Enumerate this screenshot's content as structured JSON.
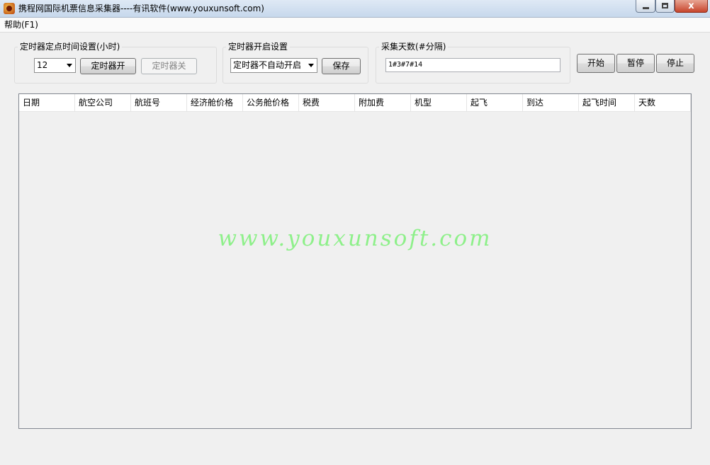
{
  "window": {
    "title": "携程网国际机票信息采集器----有讯软件(www.youxunsoft.com)",
    "close_glyph": "x"
  },
  "menu": {
    "help": "帮助(F1)"
  },
  "timer_time_group": {
    "legend": "定时器定点时间设置(小时)",
    "hour_value": "12",
    "timer_on_label": "定时器开",
    "timer_off_label": "定时器关"
  },
  "timer_start_group": {
    "legend": "定时器开启设置",
    "mode_value": "定时器不自动开启",
    "save_label": "保存"
  },
  "days_group": {
    "legend": "采集天数(#分隔)",
    "value": "1#3#7#14"
  },
  "actions": {
    "start_label": "开始",
    "pause_label": "暂停",
    "stop_label": "停止"
  },
  "table": {
    "columns": [
      "日期",
      "航空公司",
      "航班号",
      "经济舱价格",
      "公务舱价格",
      "税费",
      "附加费",
      "机型",
      "起飞",
      "到达",
      "起飞时间",
      "天数"
    ],
    "rows": []
  },
  "watermark": "www.youxunsoft.com",
  "colors": {
    "watermark": "#8ef08a",
    "close_button": "#c7452c"
  }
}
